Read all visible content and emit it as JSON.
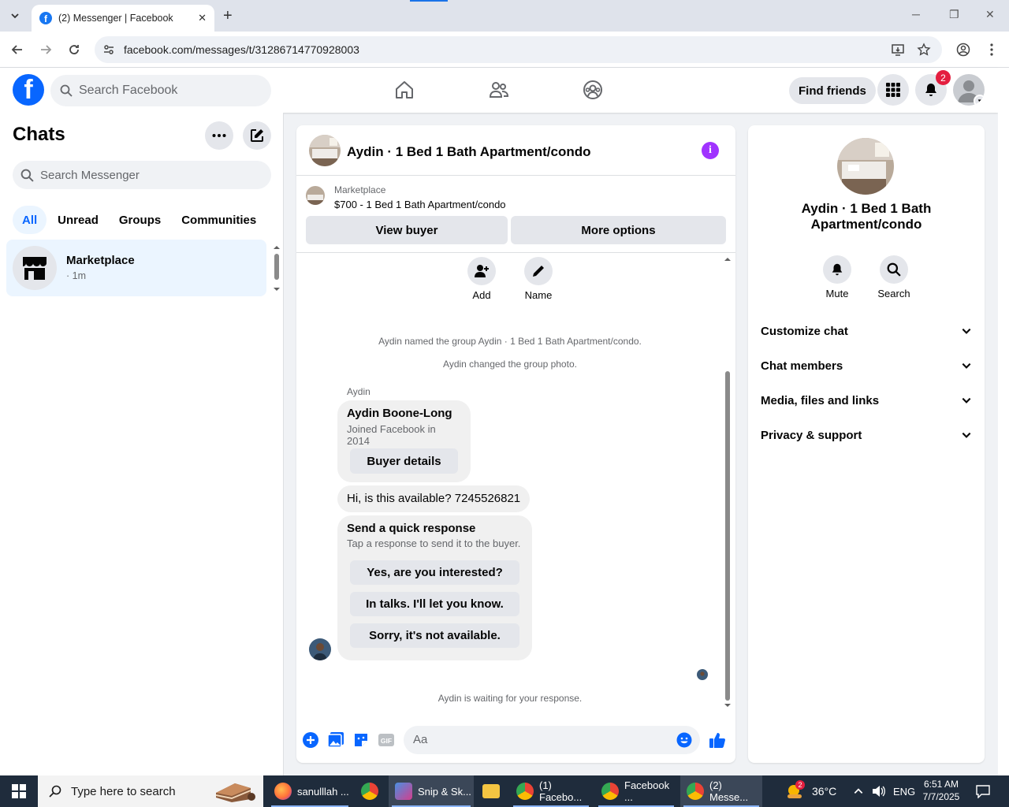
{
  "browser": {
    "tab_title": "(2) Messenger | Facebook",
    "url": "facebook.com/messages/t/31286714770928003"
  },
  "fb_header": {
    "search_placeholder": "Search Facebook",
    "find_friends": "Find friends",
    "notification_count": "2"
  },
  "sidebar": {
    "title": "Chats",
    "search_placeholder": "Search Messenger",
    "filters": [
      "All",
      "Unread",
      "Groups",
      "Communities"
    ],
    "active_filter": "All",
    "chats": [
      {
        "name": "Marketplace",
        "meta": "· 1m"
      }
    ]
  },
  "chat": {
    "title": "Aydin · 1 Bed 1 Bath Apartment/condo",
    "listing_label": "Marketplace",
    "listing_price": "$700 - 1 Bed 1 Bath Apartment/condo",
    "view_buyer": "View buyer",
    "more_options": "More options",
    "actions": {
      "add": "Add",
      "name": "Name"
    },
    "system_messages": [
      "Aydin named the group Aydin · 1 Bed 1 Bath Apartment/condo.",
      "Aydin changed the group photo."
    ],
    "sender": "Aydin",
    "profile_card": {
      "name": "Aydin Boone-Long",
      "joined": "Joined Facebook in 2014",
      "button": "Buyer details"
    },
    "message": "Hi, is this available? 7245526821",
    "quick_response": {
      "heading": "Send a quick response",
      "subtext": "Tap a response to send it to the buyer.",
      "options": [
        "Yes, are you interested?",
        "In talks. I'll let you know.",
        "Sorry, it's not available."
      ]
    },
    "waiting": "Aydin is waiting for your response.",
    "composer_placeholder": "Aa"
  },
  "details": {
    "name": "Aydin · 1 Bed 1 Bath Apartment/condo",
    "mute": "Mute",
    "search": "Search",
    "sections": [
      "Customize chat",
      "Chat members",
      "Media, files and links",
      "Privacy & support"
    ]
  },
  "taskbar": {
    "search_placeholder": "Type here to search",
    "apps": [
      {
        "label": "sanulllah ...",
        "color": "#ff7139"
      },
      {
        "label": "",
        "color": "#1a73e8"
      },
      {
        "label": "Snip & Sk...",
        "color": "#4a90e2"
      },
      {
        "label": "",
        "color": "#f4c542"
      },
      {
        "label": "(1) Facebo...",
        "color": "#1a73e8"
      },
      {
        "label": "Facebook ...",
        "color": "#1a73e8"
      },
      {
        "label": "(2) Messe...",
        "color": "#1a73e8"
      }
    ],
    "weather_badge": "2",
    "temperature": "36°C",
    "language": "ENG",
    "time": "6:51 AM",
    "date": "7/7/2025"
  },
  "colors": {
    "facebook_blue": "#0866ff",
    "info_purple": "#a033ff",
    "notification_red": "#e41e3f"
  }
}
